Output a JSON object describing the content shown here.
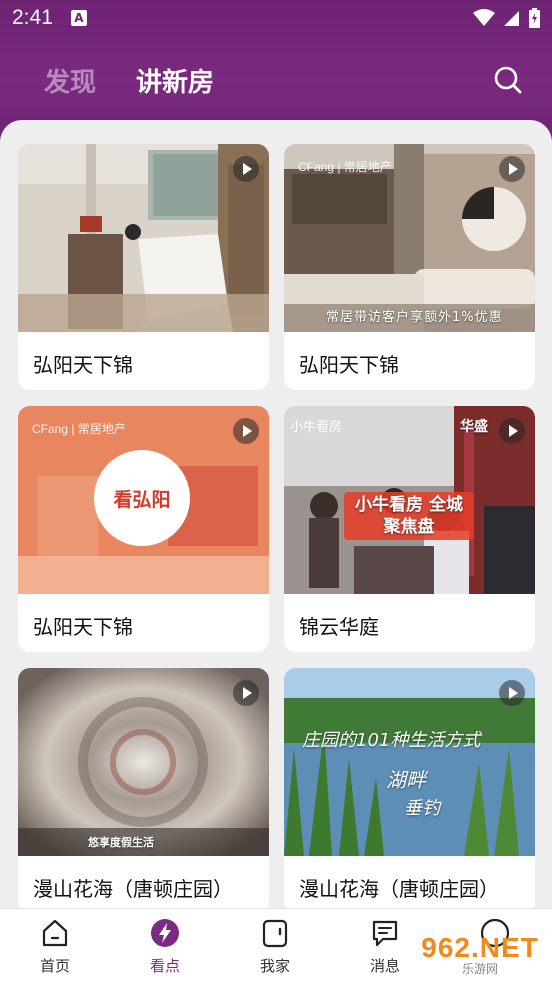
{
  "status_bar": {
    "time": "2:41",
    "notification_icon": "A"
  },
  "header": {
    "tabs": [
      {
        "label": "发现",
        "active": false
      },
      {
        "label": "讲新房",
        "active": true
      }
    ],
    "search_icon": "search-icon"
  },
  "colors": {
    "brand": "#7a2a80",
    "tab_inactive": "#b78bbb"
  },
  "cards": [
    {
      "title": "弘阳天下锦",
      "overlay": ""
    },
    {
      "title": "弘阳天下锦",
      "overlay": "常居带访客户享额外1%优惠",
      "logo": "CFang | 常居地产"
    },
    {
      "title": "弘阳天下锦",
      "overlay": "看弘阳",
      "logo": "CFang | 常居地产"
    },
    {
      "title": "锦云华庭",
      "overlay": "小牛看房 全城聚焦盘",
      "logo": "小牛看房",
      "corner_text": "华盛"
    },
    {
      "title": "漫山花海（唐顿庄园）",
      "overlay": "悠享度假生活"
    },
    {
      "title": "漫山花海（唐顿庄园）",
      "overlay": "庄园的101种生活方式",
      "overlay2": "湖畔",
      "overlay3": "垂钓"
    }
  ],
  "bottom_nav": [
    {
      "label": "首页",
      "icon": "home-icon",
      "active": false
    },
    {
      "label": "看点",
      "icon": "lightning-icon",
      "active": true
    },
    {
      "label": "我家",
      "icon": "house-door-icon",
      "active": false
    },
    {
      "label": "消息",
      "icon": "message-icon",
      "active": false
    },
    {
      "label": "",
      "icon": "profile-icon",
      "active": false
    }
  ],
  "watermark": {
    "main": "962.NET",
    "sub": "乐游网"
  }
}
